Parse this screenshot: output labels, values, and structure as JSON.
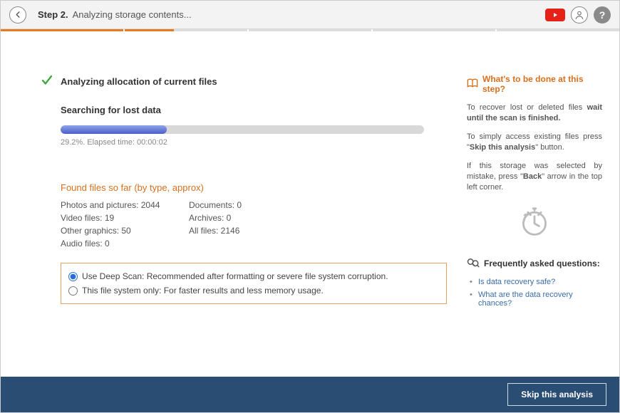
{
  "header": {
    "step_label": "Step 2.",
    "step_title": "Analyzing storage contents..."
  },
  "main": {
    "status_title": "Analyzing allocation of current files",
    "searching_title": "Searching for lost data",
    "progress_text": "29.2%. Elapsed time: 00:00:02",
    "found_title": "Found files so far (by type, approx)",
    "stats": {
      "photos_label": "Photos and pictures: 2044",
      "documents_label": "Documents: 0",
      "video_label": "Video files: 19",
      "archives_label": "Archives: 0",
      "other_label": "Other graphics: 50",
      "all_label": "All files: 2146",
      "audio_label": "Audio files: 0"
    },
    "options": {
      "deep": "Use Deep Scan: Recommended after formatting or severe file system corruption.",
      "fsonly": "This file system only: For faster results and less memory usage."
    }
  },
  "sidebar": {
    "title": "What's to be done at this step?",
    "p1_a": "To recover lost or deleted files ",
    "p1_b": "wait until the scan is finished.",
    "p2_a": "To simply access existing files press \"",
    "p2_b": "Skip this analysis",
    "p2_c": "\" button.",
    "p3_a": "If this storage was selected by mistake, press \"",
    "p3_b": "Back",
    "p3_c": "\" arrow in the top left corner.",
    "faq_title": "Frequently asked questions:",
    "faq": {
      "q1": "Is data recovery safe?",
      "q2": "What are the data recovery chances?"
    }
  },
  "footer": {
    "skip_label": "Skip this analysis"
  }
}
